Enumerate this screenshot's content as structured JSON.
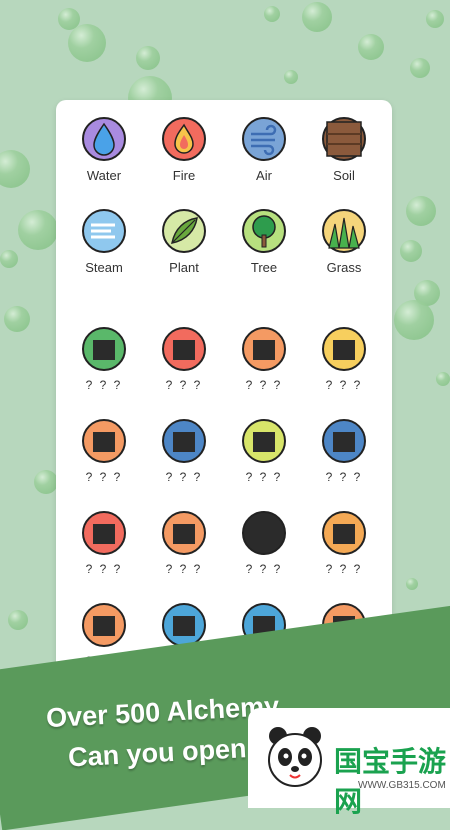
{
  "elements": [
    {
      "label": "Water",
      "icon": "water-drop-icon",
      "bg": "#a98be0",
      "accent": "#4aa2e8",
      "known": true
    },
    {
      "label": "Fire",
      "icon": "fire-icon",
      "bg": "#f26b5e",
      "accent": "#f7c34a",
      "known": true
    },
    {
      "label": "Air",
      "icon": "air-icon",
      "bg": "#7aa4d6",
      "accent": "#3d6db3",
      "known": true
    },
    {
      "label": "Soil",
      "icon": "soil-icon",
      "bg": "#8b5a3c",
      "accent": "#5c3a24",
      "known": true
    },
    {
      "label": "Steam",
      "icon": "steam-icon",
      "bg": "#8fc8ee",
      "accent": "#ffffff",
      "known": true
    },
    {
      "label": "Plant",
      "icon": "leaf-icon",
      "bg": "#d6e9a6",
      "accent": "#69a83d",
      "known": true
    },
    {
      "label": "Tree",
      "icon": "tree-icon",
      "bg": "#b7e07f",
      "accent": "#2e9c4d",
      "known": true
    },
    {
      "label": "Grass",
      "icon": "grass-icon",
      "bg": "#f5d57b",
      "accent": "#48b14d",
      "known": true
    },
    {
      "label": "? ? ?",
      "icon": "unknown-element-1-icon",
      "bg": "#5ab86a",
      "known": false
    },
    {
      "label": "? ? ?",
      "icon": "unknown-element-2-icon",
      "bg": "#f26b5e",
      "known": false
    },
    {
      "label": "? ? ?",
      "icon": "unknown-element-3-icon",
      "bg": "#f49a63",
      "known": false
    },
    {
      "label": "? ? ?",
      "icon": "unknown-element-4-icon",
      "bg": "#f7cf5e",
      "known": false
    },
    {
      "label": "? ? ?",
      "icon": "unknown-element-5-icon",
      "bg": "#f49a63",
      "known": false
    },
    {
      "label": "? ? ?",
      "icon": "unknown-element-6-icon",
      "bg": "#4d86c6",
      "known": false
    },
    {
      "label": "? ? ?",
      "icon": "unknown-element-7-icon",
      "bg": "#d8e56a",
      "known": false
    },
    {
      "label": "? ? ?",
      "icon": "unknown-element-8-icon",
      "bg": "#4d86c6",
      "known": false
    },
    {
      "label": "? ? ?",
      "icon": "unknown-element-9-icon",
      "bg": "#f26b5e",
      "known": false
    },
    {
      "label": "? ? ?",
      "icon": "unknown-element-10-icon",
      "bg": "#f49a63",
      "known": false
    },
    {
      "label": "? ? ?",
      "icon": "unknown-element-11-icon",
      "bg": "#2b2b2b",
      "known": false
    },
    {
      "label": "? ? ?",
      "icon": "unknown-element-12-icon",
      "bg": "#f4a955",
      "known": false
    },
    {
      "label": "? ? ?",
      "icon": "unknown-element-13-icon",
      "bg": "#f49a63",
      "known": false
    },
    {
      "label": "? ? ?",
      "icon": "unknown-element-14-icon",
      "bg": "#4da6d9",
      "known": false
    },
    {
      "label": "? ? ?",
      "icon": "unknown-element-15-icon",
      "bg": "#4da6d9",
      "known": false
    },
    {
      "label": "? ? ?",
      "icon": "unknown-element-16-icon",
      "bg": "#f49a63",
      "known": false
    }
  ],
  "banner": {
    "line1": "Over 500 Alchemy",
    "line2": "Can you open"
  },
  "watermark": {
    "logo_text": "国宝手游网",
    "url": "WWW.GB315.COM"
  },
  "colors": {
    "background": "#b7d7bd",
    "banner": "#5a9a5b",
    "card": "#ffffff"
  }
}
